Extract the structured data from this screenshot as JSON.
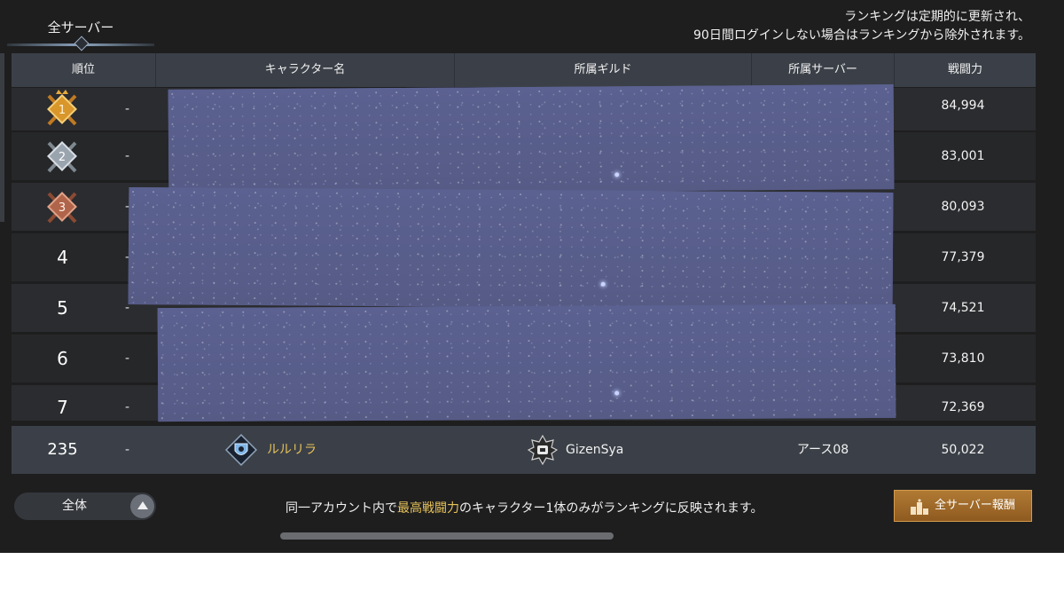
{
  "tab": {
    "label": "全サーバー"
  },
  "notice": {
    "line1": "ランキングは定期的に更新され、",
    "line2": "90日間ログインしない場合はランキングから除外されます。"
  },
  "columns": {
    "rank": "順位",
    "character": "キャラクター名",
    "guild": "所属ギルド",
    "server": "所属サーバー",
    "power": "戦闘力"
  },
  "rows": [
    {
      "rank": "1",
      "dash": "-",
      "power": "84,994"
    },
    {
      "rank": "2",
      "dash": "-",
      "power": "83,001"
    },
    {
      "rank": "3",
      "dash": "-",
      "power": "80,093"
    },
    {
      "rank": "4",
      "dash": "-",
      "power": "77,379"
    },
    {
      "rank": "5",
      "dash": "-",
      "power": "74,521"
    },
    {
      "rank": "6",
      "dash": "-",
      "power": "73,810"
    },
    {
      "rank": "7",
      "dash": "-",
      "power": "72,369"
    }
  ],
  "self": {
    "rank": "235",
    "dash": "-",
    "character": "ルルリラ",
    "guild": "GizenSya",
    "server": "アース08",
    "power": "50,022"
  },
  "footer": {
    "filter_label": "全体",
    "note_before": "同一アカウント内で",
    "note_highlight": "最高戦闘力",
    "note_after": "のキャラクター1体のみがランキングに反映されます。",
    "reward_label": "全サーバー報酬"
  },
  "colors": {
    "gold": "#e7c35a",
    "medal_gold": "#d9962a",
    "medal_silver": "#9aa4ae",
    "medal_bronze": "#b0654a",
    "reward_button": "#a06a2a"
  }
}
